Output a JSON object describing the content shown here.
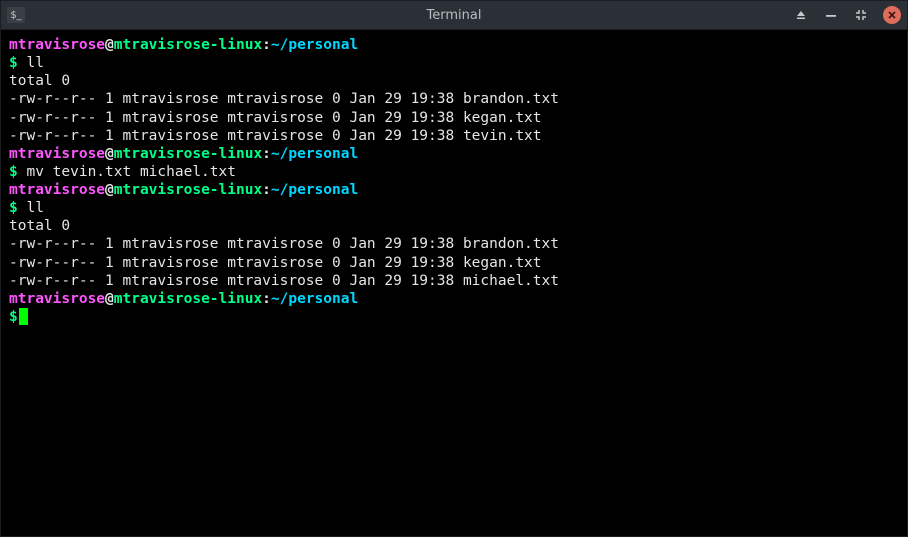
{
  "window": {
    "title": "Terminal",
    "app_icon_text": "$_"
  },
  "prompt": {
    "user": "mtravisrose",
    "at": "@",
    "host": "mtravisrose-linux",
    "colon": ":",
    "path": "~/personal",
    "symbol": "$"
  },
  "blocks": [
    {
      "command": "ll",
      "output": [
        "total 0",
        "-rw-r--r-- 1 mtravisrose mtravisrose 0 Jan 29 19:38 brandon.txt",
        "-rw-r--r-- 1 mtravisrose mtravisrose 0 Jan 29 19:38 kegan.txt",
        "-rw-r--r-- 1 mtravisrose mtravisrose 0 Jan 29 19:38 tevin.txt"
      ]
    },
    {
      "command": "mv tevin.txt michael.txt",
      "output": []
    },
    {
      "command": "ll",
      "output": [
        "total 0",
        "-rw-r--r-- 1 mtravisrose mtravisrose 0 Jan 29 19:38 brandon.txt",
        "-rw-r--r-- 1 mtravisrose mtravisrose 0 Jan 29 19:38 kegan.txt",
        "-rw-r--r-- 1 mtravisrose mtravisrose 0 Jan 29 19:38 michael.txt"
      ]
    }
  ]
}
